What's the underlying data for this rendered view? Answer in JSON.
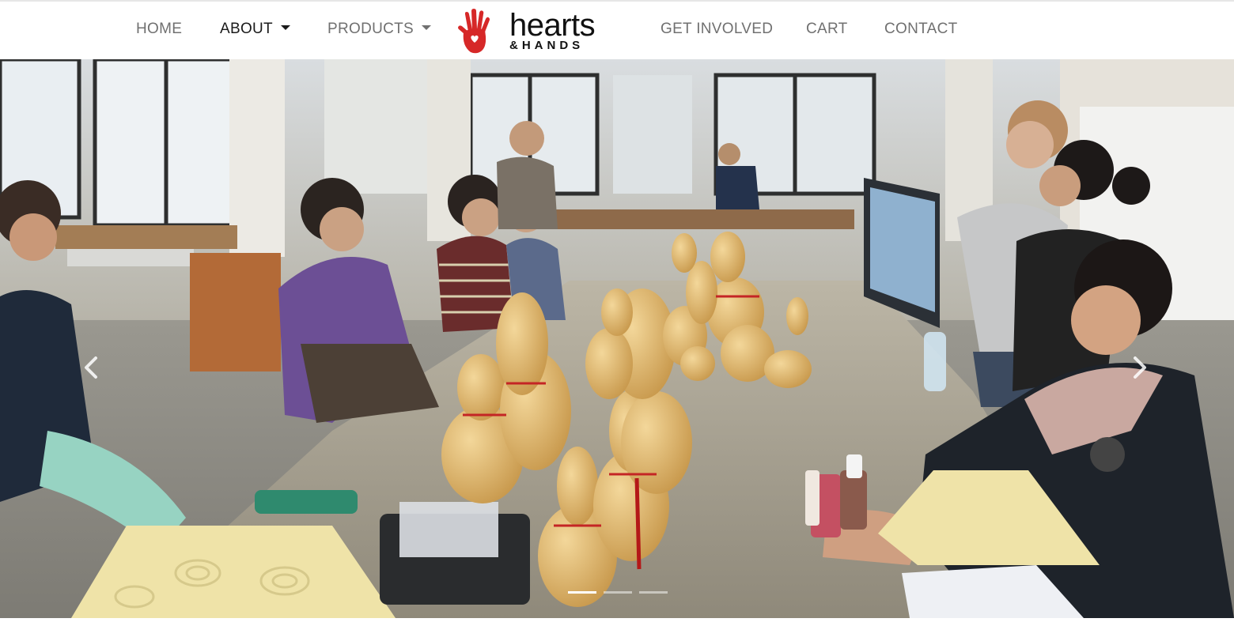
{
  "nav": {
    "home": "HOME",
    "about": "ABOUT",
    "products": "PRODUCTS",
    "get_involved": "GET INVOLVED",
    "cart": "CART",
    "contact": "CONTACT",
    "active_item": "about"
  },
  "logo": {
    "wordmark": "hearts",
    "sub": "&HANDS",
    "icon": "red-hand-with-heart-icon",
    "color": "#d62828"
  },
  "carousel": {
    "photo_description": "",
    "slide_count": 3,
    "active_slide": 1,
    "prev_icon": "chevron-left-icon",
    "next_icon": "chevron-right-icon"
  },
  "colors": {
    "nav_text": "#707070",
    "nav_active": "#1a1a1a",
    "brand_red": "#d62828"
  }
}
